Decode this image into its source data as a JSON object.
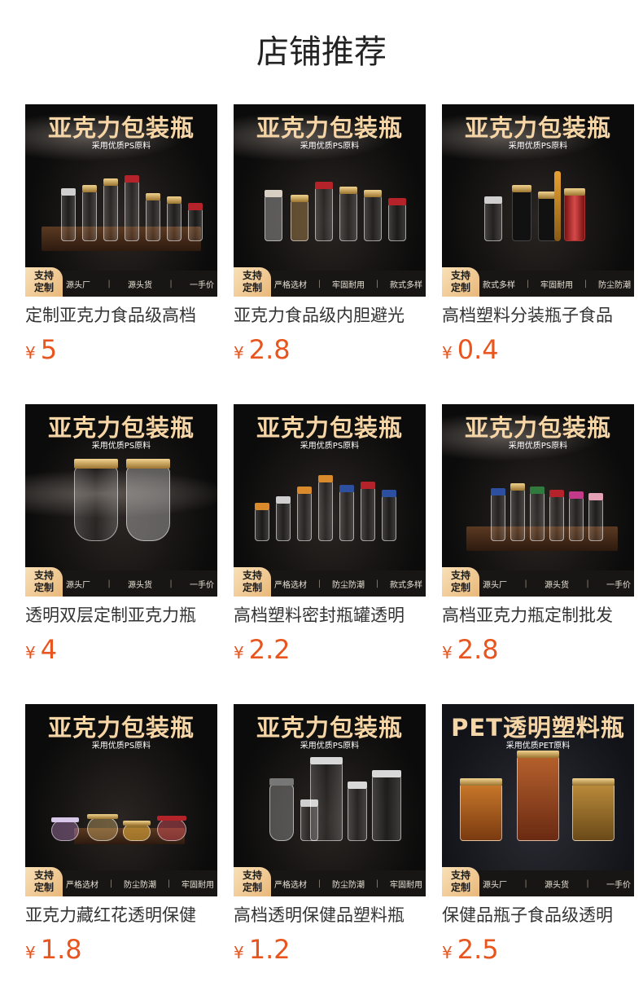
{
  "page": {
    "title": "店铺推荐"
  },
  "products": [
    {
      "name": "定制亚克力食品级高档",
      "currency": "¥",
      "price": "5",
      "banner": "亚克力包装瓶",
      "banner_sub": "采用优质PS原料",
      "badge": [
        "支持",
        "定制"
      ],
      "features": [
        "源头厂",
        "源头货",
        "一手价"
      ]
    },
    {
      "name": "亚克力食品级内胆避光",
      "currency": "¥",
      "price": "2.8",
      "banner": "亚克力包装瓶",
      "banner_sub": "采用优质PS原料",
      "badge": [
        "支持",
        "定制"
      ],
      "features": [
        "严格选材",
        "牢固耐用",
        "款式多样"
      ]
    },
    {
      "name": "高档塑料分装瓶子食品",
      "currency": "¥",
      "price": "0.4",
      "banner": "亚克力包装瓶",
      "banner_sub": "采用优质PS原料",
      "badge": [
        "支持",
        "定制"
      ],
      "features": [
        "款式多样",
        "牢固耐用",
        "防尘防潮"
      ]
    },
    {
      "name": "透明双层定制亚克力瓶",
      "currency": "¥",
      "price": "4",
      "banner": "亚克力包装瓶",
      "banner_sub": "采用优质PS原料",
      "badge": [
        "支持",
        "定制"
      ],
      "features": [
        "源头厂",
        "源头货",
        "一手价"
      ]
    },
    {
      "name": "高档塑料密封瓶罐透明",
      "currency": "¥",
      "price": "2.2",
      "banner": "亚克力包装瓶",
      "banner_sub": "采用优质PS原料",
      "badge": [
        "支持",
        "定制"
      ],
      "features": [
        "严格选材",
        "防尘防潮",
        "款式多样"
      ]
    },
    {
      "name": "高档亚克力瓶定制批发",
      "currency": "¥",
      "price": "2.8",
      "banner": "亚克力包装瓶",
      "banner_sub": "采用优质PS原料",
      "badge": [
        "支持",
        "定制"
      ],
      "features": [
        "源头厂",
        "源头货",
        "一手价"
      ]
    },
    {
      "name": "亚克力藏红花透明保健",
      "currency": "¥",
      "price": "1.8",
      "banner": "亚克力包装瓶",
      "banner_sub": "采用优质PS原料",
      "badge": [
        "支持",
        "定制"
      ],
      "features": [
        "严格选材",
        "防尘防潮",
        "牢固耐用"
      ]
    },
    {
      "name": "高档透明保健品塑料瓶",
      "currency": "¥",
      "price": "1.2",
      "banner": "亚克力包装瓶",
      "banner_sub": "采用优质PS原料",
      "badge": [
        "支持",
        "定制"
      ],
      "features": [
        "严格选材",
        "防尘防潮",
        "牢固耐用"
      ]
    },
    {
      "name": "保健品瓶子食品级透明",
      "currency": "¥",
      "price": "2.5",
      "banner": "PET透明塑料瓶",
      "banner_sub": "采用优质PET原料",
      "badge": [
        "支持",
        "定制"
      ],
      "features": [
        "源头厂",
        "源头货",
        "一手价"
      ]
    }
  ]
}
